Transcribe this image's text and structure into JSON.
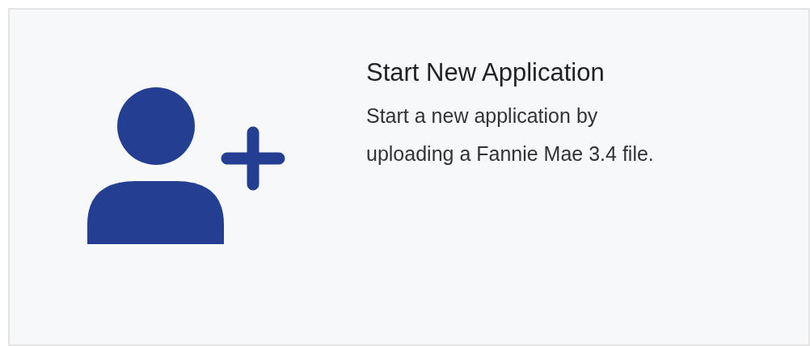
{
  "card": {
    "title": "Start New Application",
    "description": "Start a new application by uploading a Fannie Mae 3.4 file."
  }
}
